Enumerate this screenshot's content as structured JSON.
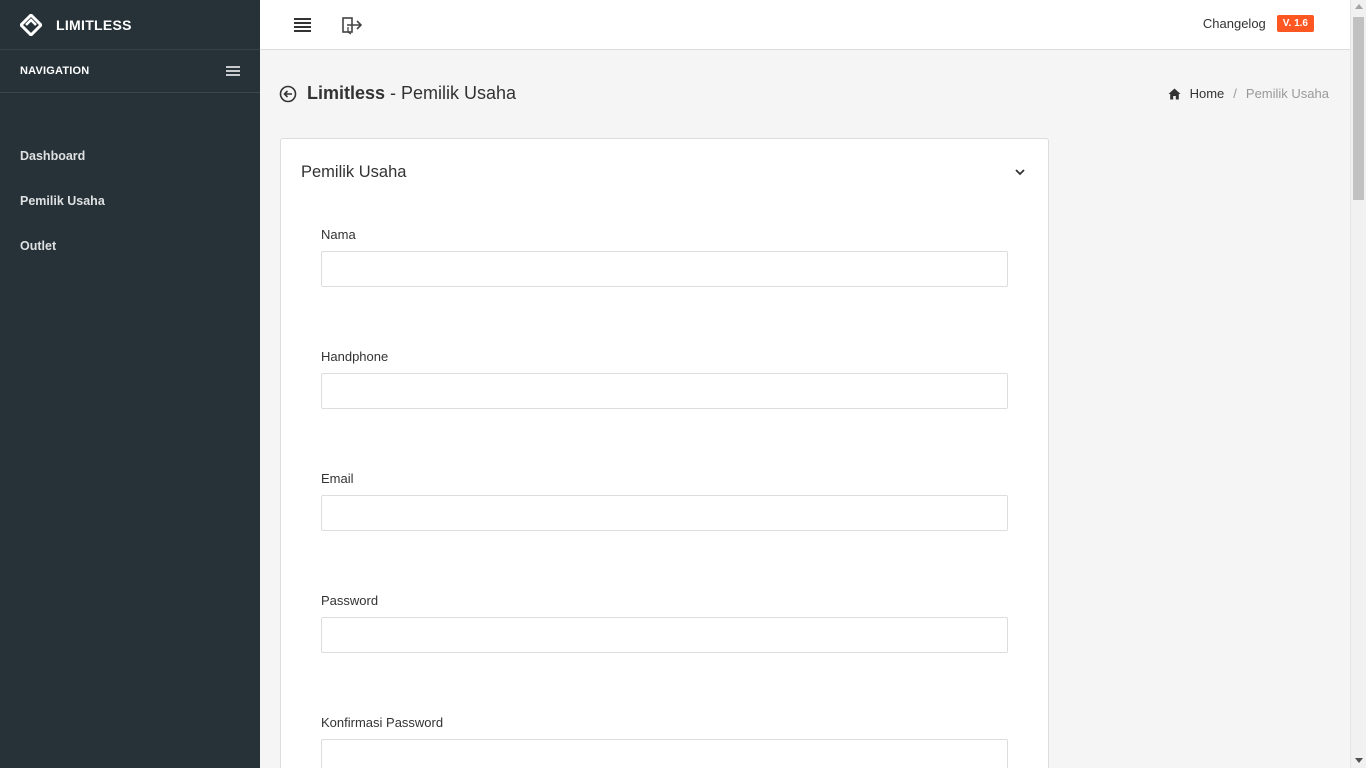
{
  "sidebar": {
    "brand": "LIMITLESS",
    "nav_header": "NAVIGATION",
    "items": [
      {
        "label": "Dashboard",
        "icon": "none"
      },
      {
        "label": "Pemilik Usaha",
        "icon": "none"
      },
      {
        "label": "Outlet",
        "icon": "none"
      }
    ]
  },
  "topbar": {
    "changelog": "Changelog",
    "version": "V. 1.6",
    "version_color": "#ff5722"
  },
  "page": {
    "title_bold": "Limitless",
    "title_rest": " - Pemilik Usaha",
    "breadcrumb": {
      "home": "Home",
      "separator": "/",
      "current": "Pemilik Usaha"
    }
  },
  "card": {
    "title": "Pemilik Usaha",
    "fields": [
      {
        "label": "Nama",
        "value": "",
        "placeholder": ""
      },
      {
        "label": "Handphone",
        "value": "",
        "placeholder": ""
      },
      {
        "label": "Email",
        "value": "",
        "placeholder": ""
      },
      {
        "label": "Password",
        "value": "",
        "placeholder": ""
      },
      {
        "label": "Konfirmasi Password",
        "value": "",
        "placeholder": ""
      }
    ]
  },
  "colors": {
    "sidebar_bg": "#263238",
    "page_bg": "#f5f5f5",
    "accent": "#ff5722"
  }
}
